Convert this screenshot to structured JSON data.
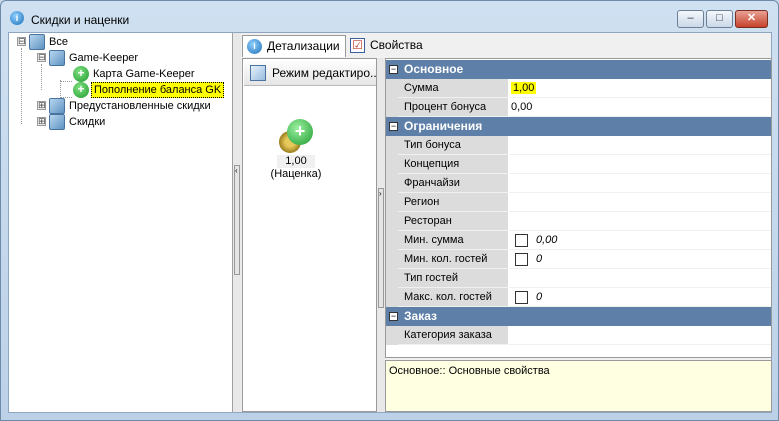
{
  "window": {
    "title": "Скидки и наценки",
    "minimize": "–",
    "maximize": "□",
    "close": "✕"
  },
  "tree": {
    "nodes": [
      {
        "label": "Все"
      },
      {
        "label": "Game-Keeper"
      },
      {
        "label": "Карта Game-Keeper"
      },
      {
        "label": "Пополнение баланса GK"
      },
      {
        "label": "Предустановленные скидки"
      },
      {
        "label": "Скидки"
      }
    ]
  },
  "tabs": [
    {
      "label": "Детализации"
    },
    {
      "label": "Свойства"
    }
  ],
  "mode_button": "Режим редактиро...",
  "item": {
    "value": "1,00",
    "caption": "(Наценка)"
  },
  "properties": {
    "basic": {
      "title": "Основное",
      "rows": [
        {
          "name": "Сумма",
          "value": "1,00"
        },
        {
          "name": "Процент бонуса",
          "value": "0,00"
        }
      ]
    },
    "limits": {
      "title": "Ограничения",
      "rows": [
        {
          "name": "Тип бонуса",
          "value": ""
        },
        {
          "name": "Концепция",
          "value": ""
        },
        {
          "name": "Франчайзи",
          "value": ""
        },
        {
          "name": "Регион",
          "value": ""
        },
        {
          "name": "Ресторан",
          "value": ""
        },
        {
          "name": "Мин. сумма",
          "value": "0,00"
        },
        {
          "name": "Мин. кол. гостей",
          "value": "0"
        },
        {
          "name": "Тип гостей",
          "value": ""
        },
        {
          "name": "Макс. кол. гостей",
          "value": "0"
        }
      ]
    },
    "order": {
      "title": "Заказ",
      "rows": [
        {
          "name": "Категория заказа",
          "value": ""
        }
      ]
    }
  },
  "description": "Основное:: Основные свойства",
  "colors": {
    "category_bg": "#5d7fa8",
    "highlight": "#ffff00",
    "desc_bg": "#ffffe1"
  },
  "icons": {
    "expand": "⊟",
    "collapse": "⊞",
    "arrow_left": "‹",
    "arrow_right": "›"
  }
}
